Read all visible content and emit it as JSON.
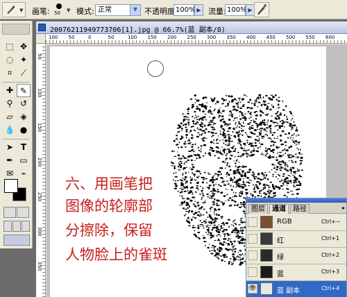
{
  "options_bar": {
    "brush_label": "画笔:",
    "brush_size": "50",
    "mode_label": "模式:",
    "mode_value": "正常",
    "opacity_label": "不透明度:",
    "opacity_value": "100%",
    "flow_label": "流量:",
    "flow_value": "100%"
  },
  "document": {
    "title": "20076211949773706[1].jpg @ 66.7%(蓝 副本/8)",
    "ruler_top": [
      "100",
      "50",
      "0",
      "50",
      "100",
      "150",
      "200",
      "250",
      "300",
      "350",
      "400",
      "450",
      "500",
      "550",
      "600"
    ],
    "ruler_left": [
      "50",
      "100",
      "150",
      "200",
      "250",
      "300",
      "350"
    ],
    "caption_lines": [
      "六、用画笔把",
      "图像的轮廓部",
      "分擦除，保留",
      "人物脸上的雀斑"
    ]
  },
  "channels_panel": {
    "tabs": [
      "图层",
      "通道",
      "路径"
    ],
    "active_tab": "通道",
    "channels": [
      {
        "name": "RGB",
        "shortcut": "Ctrl+~",
        "selected": false,
        "visible": false
      },
      {
        "name": "红",
        "shortcut": "Ctrl+1",
        "selected": false,
        "visible": false
      },
      {
        "name": "绿",
        "shortcut": "Ctrl+2",
        "selected": false,
        "visible": false
      },
      {
        "name": "蓝",
        "shortcut": "Ctrl+3",
        "selected": false,
        "visible": false
      },
      {
        "name": "蓝 副本",
        "shortcut": "Ctrl+4",
        "selected": true,
        "visible": true
      }
    ]
  },
  "colors": {
    "caption": "#c81e1e",
    "selection": "#316ac5",
    "foreground": "#ffffff",
    "background": "#000000"
  }
}
